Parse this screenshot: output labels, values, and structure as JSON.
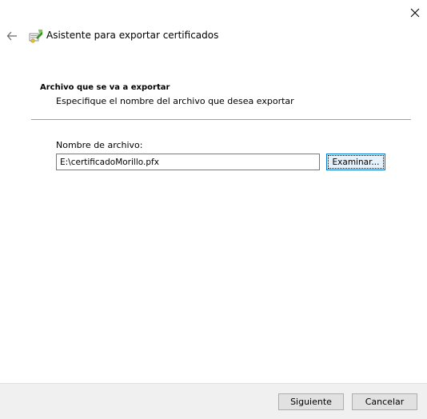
{
  "window": {
    "title": "Asistente para exportar certificados",
    "close_icon": "close-icon",
    "back_icon": "back-arrow-icon",
    "wizard_icon": "certificate-wizard-icon"
  },
  "section": {
    "heading": "Archivo que se va a exportar",
    "description": "Especifique el nombre del archivo que desea exportar"
  },
  "file": {
    "label": "Nombre de archivo:",
    "value": "E:\\certificadoMorillo.pfx",
    "browse_label": "Examinar..."
  },
  "footer": {
    "next_label": "Siguiente",
    "cancel_label": "Cancelar"
  },
  "colors": {
    "accent": "#0078d7",
    "footer_bg": "#f0f0f0",
    "divider": "#a0a0a0"
  }
}
